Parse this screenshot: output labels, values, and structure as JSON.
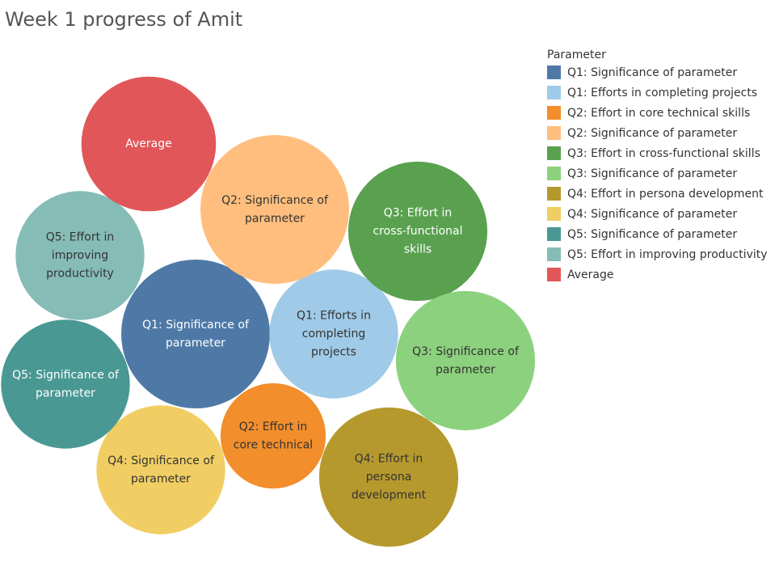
{
  "chart_data": {
    "type": "packed-bubble",
    "title": "Week 1 progress of Amit",
    "legend_title": "Parameter",
    "legend_position": "right",
    "series": [
      {
        "name": "Q1: Significance of parameter",
        "bubble_label": [
          "Q1: Significance of",
          "parameter"
        ],
        "value": 100,
        "color": "#4e79a7",
        "text_color": "#ffffff"
      },
      {
        "name": "Q1: Efforts in completing projects",
        "bubble_label": [
          "Q1: Efforts in",
          "completing",
          "projects"
        ],
        "value": 75,
        "color": "#a0cbe8",
        "text_color": "#333333"
      },
      {
        "name": "Q2: Effort in core technical skills",
        "bubble_label": [
          "Q2: Effort in",
          "core technical"
        ],
        "value": 50,
        "color": "#f28e2b",
        "text_color": "#333333"
      },
      {
        "name": "Q2: Significance of parameter",
        "bubble_label": [
          "Q2: Significance of",
          "parameter"
        ],
        "value": 100,
        "color": "#ffbe7d",
        "text_color": "#333333"
      },
      {
        "name": "Q3: Effort in cross-functional skills",
        "bubble_label": [
          "Q3: Effort in",
          "cross-functional",
          "skills"
        ],
        "value": 87.5,
        "color": "#59a14f",
        "text_color": "#ffffff"
      },
      {
        "name": "Q3: Significance of parameter",
        "bubble_label": [
          "Q3: Significance of",
          "parameter"
        ],
        "value": 87.5,
        "color": "#8cd17d",
        "text_color": "#333333"
      },
      {
        "name": "Q4: Effort in persona development",
        "bubble_label": [
          "Q4: Effort in",
          "persona",
          "development"
        ],
        "value": 87.5,
        "color": "#b6992d",
        "text_color": "#333333"
      },
      {
        "name": "Q4: Significance of parameter",
        "bubble_label": [
          "Q4: Significance of",
          "parameter"
        ],
        "value": 75,
        "color": "#f1ce63",
        "text_color": "#333333"
      },
      {
        "name": "Q5: Significance of parameter",
        "bubble_label": [
          "Q5: Significance of",
          "parameter"
        ],
        "value": 75,
        "color": "#499894",
        "text_color": "#ffffff"
      },
      {
        "name": "Q5: Effort in improving productivity",
        "bubble_label": [
          "Q5: Effort in",
          "improving",
          "productivity"
        ],
        "value": 75,
        "color": "#86bcb6",
        "text_color": "#333333"
      },
      {
        "name": "Average",
        "bubble_label": [
          "Average"
        ],
        "value": 82,
        "color": "#e15759",
        "text_color": "#ffffff"
      }
    ]
  }
}
